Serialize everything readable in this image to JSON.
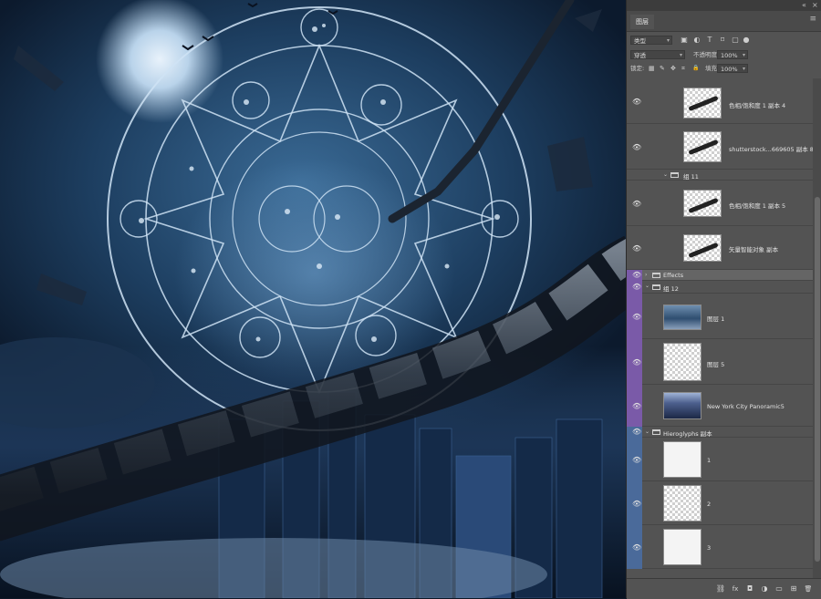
{
  "panel": {
    "collapse_glyph": "«",
    "close_glyph": "×",
    "tab_label": "图层",
    "menu_glyph": "≡",
    "filter": {
      "kind_value": "类型",
      "icons": [
        "image-filter-icon",
        "adjustment-filter-icon",
        "type-filter-icon",
        "shape-filter-icon",
        "smart-object-filter-icon",
        "toggle-filter-icon"
      ],
      "icon_glyphs": [
        "▣",
        "◐",
        "T",
        "⌑",
        "▢",
        "●"
      ]
    },
    "blend": {
      "mode_value": "穿透",
      "opacity_label": "不透明度:",
      "opacity_value": "100%"
    },
    "lock": {
      "label": "锁定:",
      "icons": [
        "lock-transparent-icon",
        "lock-brush-icon",
        "lock-move-icon",
        "lock-artboard-icon",
        "lock-all-icon"
      ],
      "icon_glyphs": [
        "▦",
        "✎",
        "✥",
        "⌗",
        "🔒"
      ],
      "fill_label": "填充:",
      "fill_value": "100%"
    },
    "layers": [
      {
        "name": "色相/饱和度 1 副本 4",
        "type": "smart",
        "eye": true,
        "color": ""
      },
      {
        "name": "shutterstock...669605 副本 8",
        "type": "smart",
        "eye": true,
        "color": ""
      },
      {
        "name": "组 11",
        "type": "group",
        "eye": false,
        "color": ""
      },
      {
        "name": "色相/饱和度 1 副本 5",
        "type": "smart",
        "eye": true,
        "color": ""
      },
      {
        "name": "矢量智能对象 副本",
        "type": "smart",
        "eye": true,
        "color": ""
      },
      {
        "name": "Effects",
        "type": "group-collapsed",
        "eye": true,
        "color": "#7a5aa8"
      },
      {
        "name": "组 12",
        "type": "group",
        "eye": true,
        "color": "#7a5aa8"
      },
      {
        "name": "图层 1",
        "type": "image",
        "eye": true,
        "color": "#7a5aa8"
      },
      {
        "name": "图层 5",
        "type": "blank",
        "eye": true,
        "color": "#7a5aa8"
      },
      {
        "name": "New York City Panoramic5",
        "type": "city",
        "eye": true,
        "color": "#7a5aa8"
      },
      {
        "name": "Hieroglyphs 副本",
        "type": "group",
        "eye": true,
        "color": "#4a6a9a"
      },
      {
        "name": "1",
        "type": "stroke-light",
        "eye": true,
        "color": "#4a6a9a"
      },
      {
        "name": "2",
        "type": "blank",
        "eye": true,
        "color": "#4a6a9a"
      },
      {
        "name": "3",
        "type": "stroke-light",
        "eye": true,
        "color": "#4a6a9a"
      }
    ],
    "bottom_icons": [
      "link-icon",
      "fx-icon",
      "mask-icon",
      "adjustment-icon",
      "folder-icon",
      "new-layer-icon",
      "trash-icon"
    ],
    "bottom_glyphs": [
      "⛓",
      "fx",
      "◘",
      "◑",
      "▭",
      "⊞",
      "🗑"
    ]
  },
  "colors": {
    "panel_bg": "#535353",
    "purple_label": "#7a5aa8",
    "blue_label": "#4a6a9a"
  }
}
